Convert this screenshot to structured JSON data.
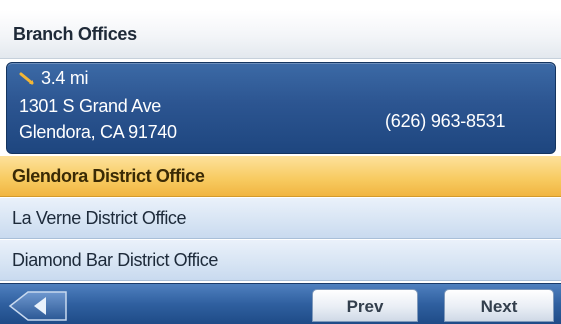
{
  "header": {
    "title": "Branch Offices"
  },
  "details": {
    "route_icon": "route-arrow-icon",
    "distance": "3.4 mi",
    "address_line1": "1301 S Grand Ave",
    "address_line2": "Glendora, CA 91740",
    "phone": "(626) 963-8531"
  },
  "list": {
    "items": [
      {
        "label": "Glendora District Office",
        "selected": true
      },
      {
        "label": "La Verne District Office",
        "selected": false
      },
      {
        "label": "Diamond Bar District Office",
        "selected": false
      }
    ]
  },
  "footer": {
    "back_icon": "back-arrow-icon",
    "prev_label": "Prev",
    "next_label": "Next"
  },
  "colors": {
    "card_blue": "#2c5591",
    "selected_orange": "#f8cc63",
    "row_blue": "#d8e5f4",
    "footer_blue": "#2f5f9f"
  }
}
